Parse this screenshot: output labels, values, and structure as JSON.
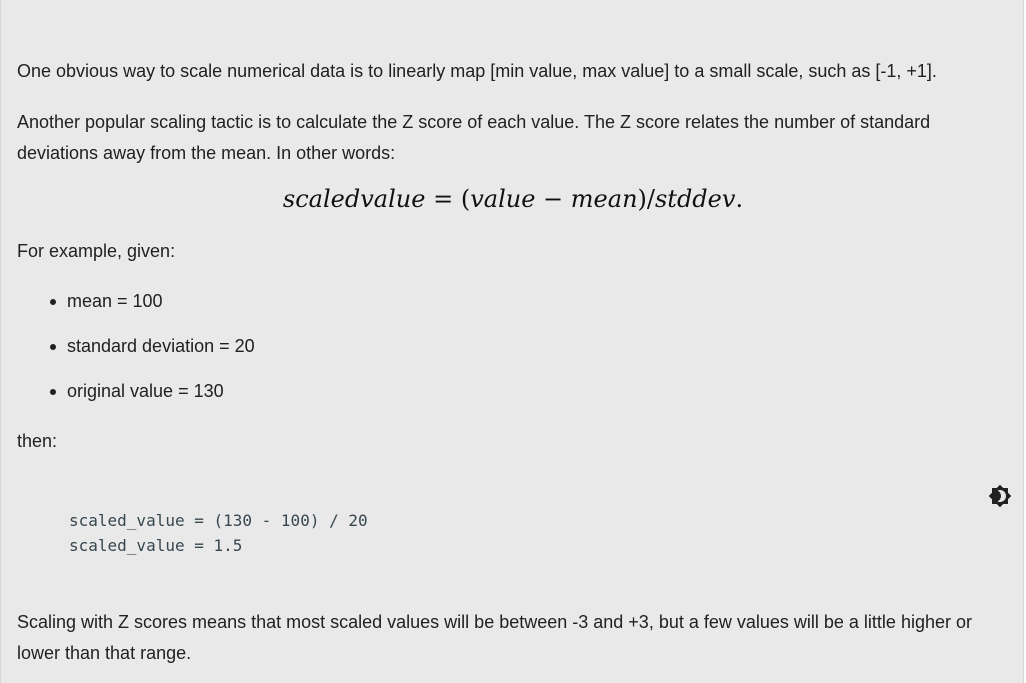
{
  "paragraphs": {
    "p1": "One obvious way to scale numerical data is to linearly map [min value, max value] to a small scale, such as [-1, +1].",
    "p2": "Another popular scaling tactic is to calculate the Z score of each value. The Z score relates the number of standard deviations away from the mean. In other words:",
    "p3": "For example, given:",
    "p4": "then:",
    "p5": "Scaling with Z scores means that most scaled values will be between -3 and +3, but a few values will be a little higher or lower than that range."
  },
  "formula": {
    "lhs": "scaledvalue",
    "equals": "=",
    "open": "(",
    "value": "value",
    "minus": "−",
    "mean": "mean",
    "close": ")/",
    "stddev": "stddev",
    "end": "."
  },
  "bullets": [
    "mean = 100",
    "standard deviation = 20",
    "original value = 130"
  ],
  "code": {
    "line1": "scaled_value = (130 - 100) / 20",
    "line2": "scaled_value = 1.5"
  },
  "icons": {
    "theme_toggle": "brightness-icon"
  }
}
